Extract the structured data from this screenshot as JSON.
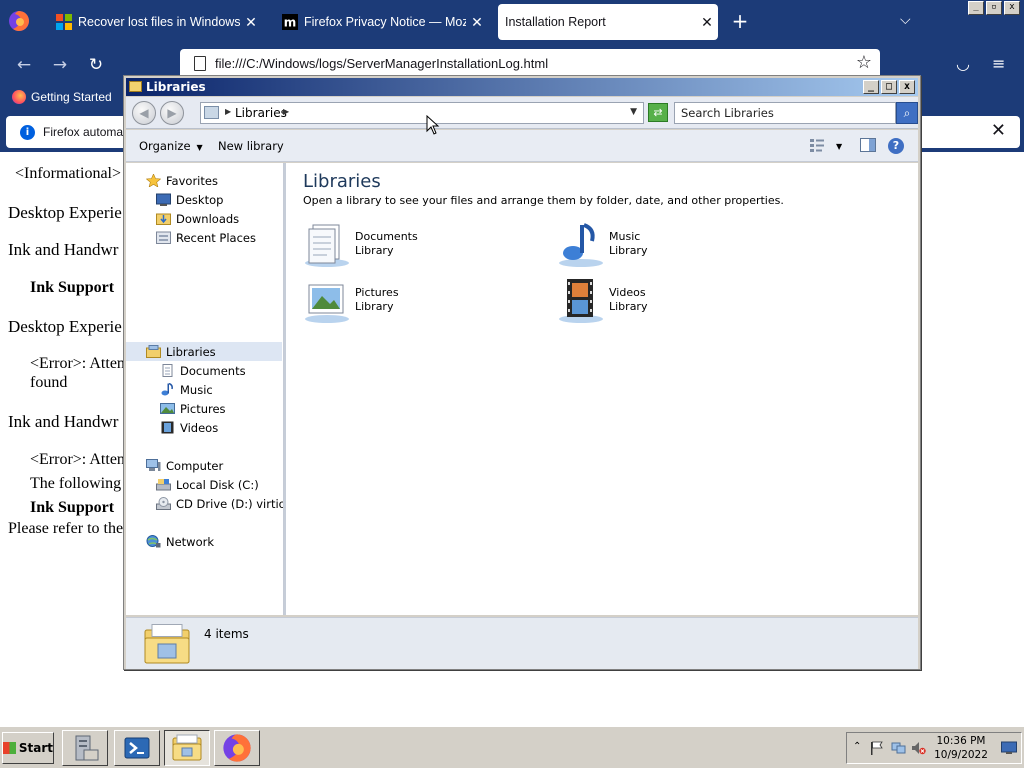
{
  "browser": {
    "tabs": [
      {
        "title": "Recover lost files in Windows Server",
        "close": "✕"
      },
      {
        "title": "Firefox Privacy Notice — Mozilla",
        "close": "✕"
      },
      {
        "title": "Installation Report",
        "close": "✕"
      }
    ],
    "new_tab": "+",
    "tab_list": "⌵",
    "url": "file:///C:/Windows/logs/ServerManagerInstallationLog.html",
    "bookmark": "Getting Started",
    "notice": "Firefox automati",
    "notice_close": "✕"
  },
  "page": {
    "lines": [
      "<Informational>",
      "Desktop Experie",
      "Ink and Handwr",
      "Ink Support",
      "Desktop Experie",
      "<Error>: Atten",
      "found",
      "Ink and Handwr",
      "<Error>: Atten",
      "The following",
      "Ink Support",
      "Please refer to the"
    ]
  },
  "explorer": {
    "title": "Libraries",
    "address": "Libraries",
    "search_placeholder": "Search Libraries",
    "toolbar": {
      "organize": "Organize",
      "new_library": "New library"
    },
    "nav": {
      "favorites": "Favorites",
      "desktop": "Desktop",
      "downloads": "Downloads",
      "recent": "Recent Places",
      "libraries": "Libraries",
      "documents": "Documents",
      "music": "Music",
      "pictures": "Pictures",
      "videos": "Videos",
      "computer": "Computer",
      "local_disk": "Local Disk (C:)",
      "cd_drive": "CD Drive (D:) virtio-win",
      "network": "Network"
    },
    "heading": "Libraries",
    "subheading": "Open a library to see your files and arrange them by folder, date, and other properties.",
    "libraries": [
      {
        "name": "Documents",
        "kind": "Library"
      },
      {
        "name": "Music",
        "kind": "Library"
      },
      {
        "name": "Pictures",
        "kind": "Library"
      },
      {
        "name": "Videos",
        "kind": "Library"
      }
    ],
    "item_count": "4 items"
  },
  "taskbar": {
    "start": "Start",
    "time": "10:36 PM",
    "date": "10/9/2022"
  }
}
